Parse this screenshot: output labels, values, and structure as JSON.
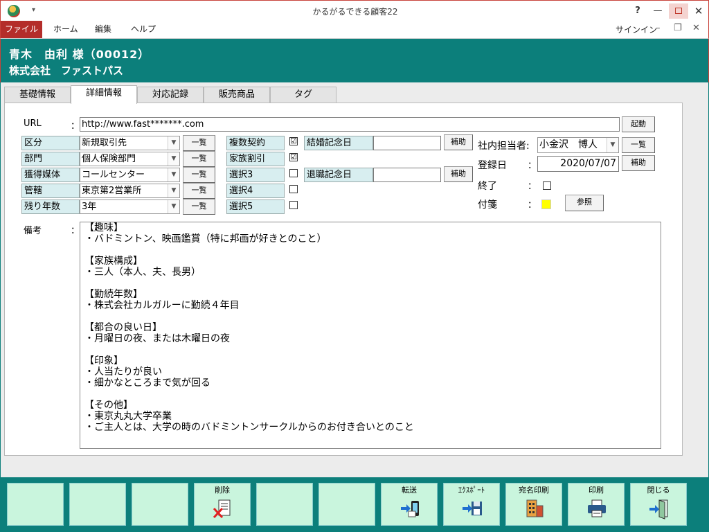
{
  "window": {
    "title": "かるがるできる顧客22",
    "help": "?",
    "minimize": "—",
    "close": "✕"
  },
  "ribbon": {
    "tabs": [
      "ファイル",
      "ホーム",
      "編集",
      "ヘルプ"
    ],
    "signin": "サインイン",
    "min": "–",
    "restore": "❐",
    "close": "✕"
  },
  "header": {
    "customer": "青木　由利 様（00012）",
    "company": "株式会社　ファストパス"
  },
  "tabs": [
    "基礎情報",
    "詳細情報",
    "対応記録",
    "販売商品",
    "タグ"
  ],
  "form": {
    "url_label": "URL",
    "colon": "：",
    "url_value": "http://www.fast*******.com",
    "launch_btn": "起動",
    "rows": [
      {
        "label": "区分",
        "value": "新規取引先"
      },
      {
        "label": "部門",
        "value": "個人保険部門"
      },
      {
        "label": "獲得媒体",
        "value": "コールセンター"
      },
      {
        "label": "管轄",
        "value": "東京第2営業所"
      },
      {
        "label": "残り年数",
        "value": "3年"
      }
    ],
    "list_btn": "一覧",
    "checks": [
      {
        "label": "複数契約",
        "checked": "☑"
      },
      {
        "label": "家族割引",
        "checked": "☑"
      },
      {
        "label": "選択3",
        "checked": ""
      },
      {
        "label": "選択4",
        "checked": ""
      },
      {
        "label": "選択5",
        "checked": ""
      }
    ],
    "marriage_label": "結婚記念日",
    "retire_label": "退職記念日",
    "aux_btn": "補助",
    "staff_label": "社内担当者:",
    "staff_value": "小金沢　博人",
    "reg_label": "登録日",
    "reg_value": "2020/07/07",
    "end_label": "終了",
    "tag_label": "付箋",
    "ref_btn": "参照",
    "memo_label": "備考",
    "memo": "【趣味】\n・バドミントン、映画鑑賞（特に邦画が好きとのこと）\n\n【家族構成】\n・三人（本人、夫、長男）\n\n【勤続年数】\n・株式会社カルガルーに勤続４年目\n\n【都合の良い日】\n・月曜日の夜、または木曜日の夜\n\n【印象】\n・人当たりが良い\n・細かなところまで気が回る\n\n【その他】\n・東京丸丸大学卒業\n・ご主人とは、大学の時のバドミントンサークルからのお付き合いとのこと"
  },
  "footer": {
    "buttons": [
      "",
      "",
      "",
      "削除",
      "",
      "",
      "転送",
      "ｴｸｽﾎﾟｰﾄ",
      "宛名印刷",
      "印刷",
      "閉じる"
    ]
  },
  "colors": {
    "teal": "#0c7f7b",
    "file_tab": "#b42d2a",
    "cell_bg": "#d8eef0",
    "footer_btn": "#c9f5dd",
    "tag_color": "#ffff00"
  }
}
